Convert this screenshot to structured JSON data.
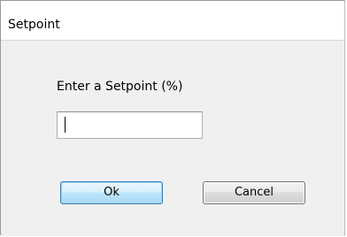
{
  "window": {
    "title": "Setpoint"
  },
  "form": {
    "prompt": "Enter a Setpoint (%)",
    "setpoint_value": ""
  },
  "buttons": {
    "ok_label": "Ok",
    "cancel_label": "Cancel"
  },
  "colors": {
    "dialog_background": "#f0f0f0",
    "title_background": "#ffffff",
    "default_button_border": "#3c7fb1"
  }
}
